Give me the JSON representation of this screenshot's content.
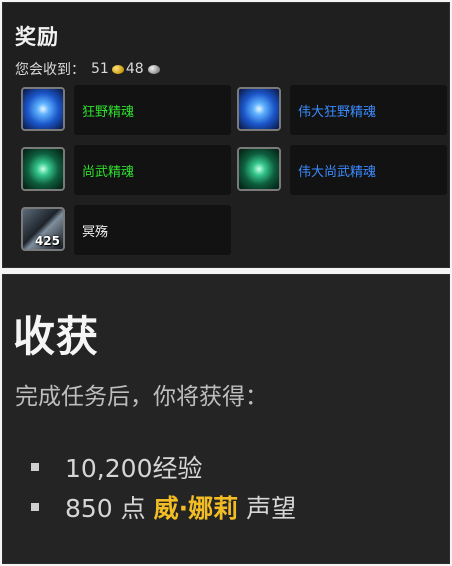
{
  "rewards": {
    "title": "奖励",
    "receive_label": "您会收到：",
    "gold": "51",
    "silver": "48",
    "items": [
      {
        "name": "狂野精魂",
        "quality": "green",
        "icon": "blue-soul-icon",
        "count": ""
      },
      {
        "name": "伟大狂野精魂",
        "quality": "blue",
        "icon": "blue-soul-icon",
        "count": ""
      },
      {
        "name": "尚武精魂",
        "quality": "green",
        "icon": "green-soul-icon",
        "count": ""
      },
      {
        "name": "伟大尚武精魂",
        "quality": "blue",
        "icon": "green-soul-icon",
        "count": ""
      },
      {
        "name": "冥殇",
        "quality": "white",
        "icon": "dark-shard-icon",
        "count": "425"
      }
    ]
  },
  "gains": {
    "title": "收获",
    "subtitle": "完成任务后，你将获得：",
    "xp": "10,200经验",
    "rep_amount": "850 点",
    "rep_faction": "威·娜莉",
    "rep_suffix": "声望"
  },
  "colors": {
    "green_item": "#2ee02e",
    "blue_item": "#3a8bff",
    "faction_gold": "#f2bd24"
  }
}
